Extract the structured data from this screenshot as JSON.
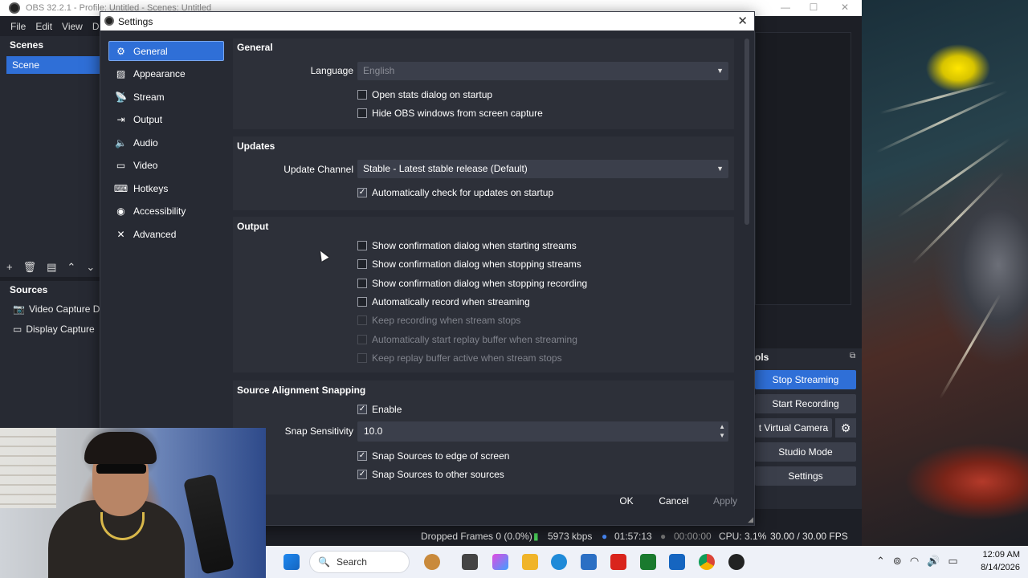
{
  "obs": {
    "title": "OBS 32.2.1 - Profile: Untitled - Scenes: Untitled",
    "menu": [
      "File",
      "Edit",
      "View",
      "De"
    ],
    "scenes_title": "Scenes",
    "scene_item": "Scene",
    "sources_title": "Sources",
    "sources": [
      "Video Capture De",
      "Display Capture"
    ],
    "controls_title": "ols",
    "controls": {
      "stop_streaming": "Stop Streaming",
      "start_recording": "Start Recording",
      "virtual_camera": "t Virtual Camera",
      "studio_mode": "Studio Mode",
      "settings": "Settings"
    },
    "status": {
      "dropped_frames": "Dropped Frames 0 (0.0%)",
      "bitrate": "5973 kbps",
      "stream_time": "01:57:13",
      "record_time": "00:00:00",
      "cpu": "CPU: 3.1%",
      "fps": "30.00 / 30.00 FPS"
    },
    "colors": {
      "accent": "#2f6fd7",
      "panel": "#272a33",
      "group": "#2d3039"
    }
  },
  "settings": {
    "title": "Settings",
    "nav": [
      {
        "label": "General",
        "icon": "gear-icon"
      },
      {
        "label": "Appearance",
        "icon": "brush-icon"
      },
      {
        "label": "Stream",
        "icon": "antenna-icon"
      },
      {
        "label": "Output",
        "icon": "output-icon"
      },
      {
        "label": "Audio",
        "icon": "speaker-icon"
      },
      {
        "label": "Video",
        "icon": "monitor-icon"
      },
      {
        "label": "Hotkeys",
        "icon": "keyboard-icon"
      },
      {
        "label": "Accessibility",
        "icon": "accessibility-icon"
      },
      {
        "label": "Advanced",
        "icon": "wrench-icon"
      }
    ],
    "general": {
      "title": "General",
      "language_label": "Language",
      "language_value": "English",
      "open_stats": "Open stats dialog on startup",
      "hide_obs": "Hide OBS windows from screen capture"
    },
    "updates": {
      "title": "Updates",
      "channel_label": "Update Channel",
      "channel_value": "Stable - Latest stable release (Default)",
      "auto_check": "Automatically check for updates on startup"
    },
    "output": {
      "title": "Output",
      "confirm_start": "Show confirmation dialog when starting streams",
      "confirm_stop": "Show confirmation dialog when stopping streams",
      "confirm_stop_rec": "Show confirmation dialog when stopping recording",
      "auto_record": "Automatically record when streaming",
      "keep_recording": "Keep recording when stream stops",
      "auto_replay": "Automatically start replay buffer when streaming",
      "keep_replay": "Keep replay buffer active when stream stops"
    },
    "snapping": {
      "title": "Source Alignment Snapping",
      "enable": "Enable",
      "sensitivity_label": "Snap Sensitivity",
      "sensitivity_value": "10.0",
      "edge": "Snap Sources to edge of screen",
      "other": "Snap Sources to other sources"
    },
    "buttons": {
      "ok": "OK",
      "cancel": "Cancel",
      "apply": "Apply"
    }
  },
  "taskbar": {
    "search_placeholder": "Search",
    "time": "12:09 AM",
    "date": "8/14/2026"
  }
}
